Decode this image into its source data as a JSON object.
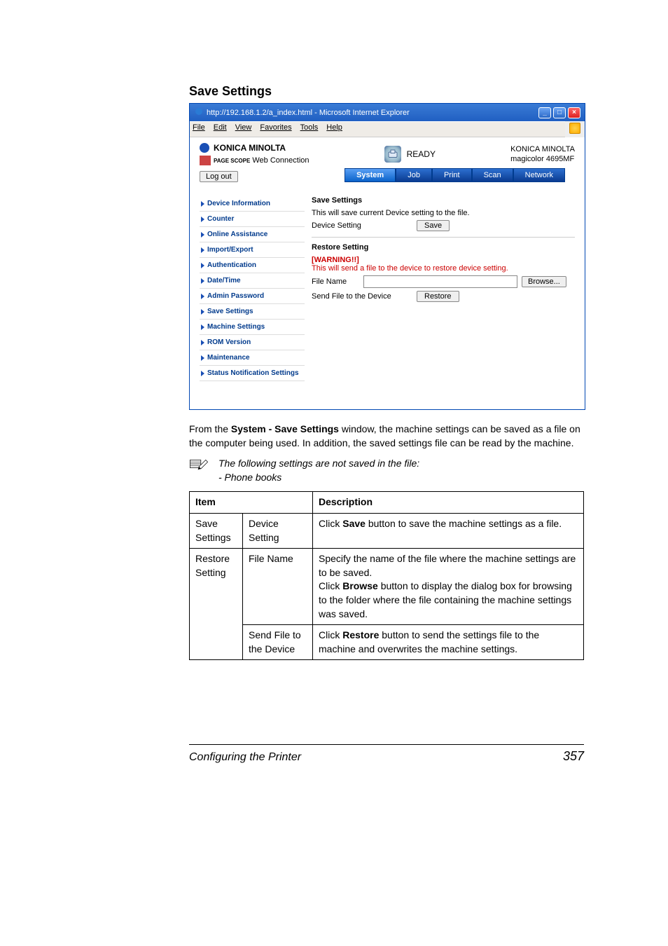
{
  "section_title": "Save Settings",
  "browser": {
    "title": "http://192.168.1.2/a_index.html - Microsoft Internet Explorer",
    "menu": {
      "file": "File",
      "edit": "Edit",
      "view": "View",
      "favorites": "Favorites",
      "tools": "Tools",
      "help": "Help"
    },
    "logo_text": "KONICA MINOLTA",
    "pagescope_text": "Web Connection",
    "pagescope_prefix": "PAGE SCOPE",
    "ready": "READY",
    "device_brand": "KONICA MINOLTA",
    "device_model": "magicolor 4695MF",
    "logout": "Log out",
    "tabs": {
      "system": "System",
      "job": "Job",
      "print": "Print",
      "scan": "Scan",
      "network": "Network"
    },
    "nav": [
      "Device Information",
      "Counter",
      "Online Assistance",
      "Import/Export",
      "Authentication",
      "Date/Time",
      "Admin Password",
      "Save Settings",
      "Machine Settings",
      "ROM Version",
      "Maintenance",
      "Status Notification Settings"
    ],
    "panel": {
      "save_settings_title": "Save Settings",
      "save_desc": "This will save current Device setting to the file.",
      "device_setting_label": "Device Setting",
      "save_btn": "Save",
      "restore_title": "Restore Setting",
      "warning": "[WARNING!!]",
      "warning_text": "This will send a file to the device to restore device setting.",
      "file_name_label": "File Name",
      "browse_btn": "Browse...",
      "send_file_label": "Send File to the Device",
      "restore_btn": "Restore"
    }
  },
  "prose": {
    "p1_a": "From the ",
    "p1_b": "System - Save Settings",
    "p1_c": " window, the machine settings can be saved as a file on the computer being used. In addition, the saved settings file can be read by the machine.",
    "note_line1": "The following settings are not saved in the file:",
    "note_line2": "- Phone books"
  },
  "table": {
    "head_item": "Item",
    "head_desc": "Description",
    "r1_c1": "Save Settings",
    "r1_c2": "Device Setting",
    "r1_c3_a": "Click ",
    "r1_c3_b": "Save",
    "r1_c3_c": " button to save the machine settings as a file.",
    "r2_c1": "Restore Setting",
    "r2a_c2": "File Name",
    "r2a_c3_a": "Specify the name of the file where the machine settings are to be saved.",
    "r2a_c3_b": "Click ",
    "r2a_c3_c": "Browse",
    "r2a_c3_d": " button to display the dialog box for browsing to the folder where the file containing the machine settings was saved.",
    "r2b_c2": "Send File to the Device",
    "r2b_c3_a": "Click ",
    "r2b_c3_b": "Restore",
    "r2b_c3_c": " button to send the settings file to the machine and overwrites the machine settings."
  },
  "footer": {
    "left": "Configuring the Printer",
    "right": "357"
  }
}
